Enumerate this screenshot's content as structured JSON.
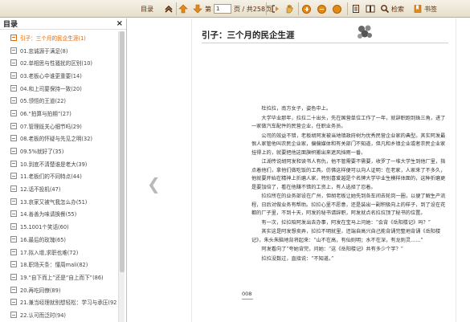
{
  "toolbar": {
    "toc_label": "目录",
    "page_prefix": "第",
    "page_value": "1",
    "page_suffix": "页 / 共258页",
    "search_label": "检索",
    "bookmark_label": "书签"
  },
  "sidebar": {
    "title": "目录",
    "close": "×",
    "items": [
      {
        "label": "引子：三个月的民企生涯(1)",
        "active": true
      },
      {
        "label": "01.忠诚源于满足(8)"
      },
      {
        "label": "02.单相思与性骚扰的区别(10)"
      },
      {
        "label": "03.老板心中谁更重要(14)"
      },
      {
        "label": "04.和上司要保持一致(20)"
      },
      {
        "label": "05.领悟的王道(22)"
      },
      {
        "label": "06.“拍算与拍期”(27)"
      },
      {
        "label": "07.管理既关心细节吗(29)"
      },
      {
        "label": "08.老板的怀疑与先见之明(32)"
      },
      {
        "label": "09.5%就好了(35)"
      },
      {
        "label": "10.到底不清楚谁是老大(39)"
      },
      {
        "label": "11.老板们的不同特点(44)"
      },
      {
        "label": "12.话不投机(47)"
      },
      {
        "label": "13.哀家又被气我怎么办(51)"
      },
      {
        "label": "14.善善为味请换餐(55)"
      },
      {
        "label": "15.1001个笑话(60)"
      },
      {
        "label": "16.最后的玫瑰(65)"
      },
      {
        "label": "17.拟入增,求职也难(72)"
      },
      {
        "label": "18.职场天条：懂周mali(82)"
      },
      {
        "label": "19.“自下而上”还是“自上而下”(86)"
      },
      {
        "label": "20.再吃同僚(89)"
      },
      {
        "label": "21.兼当经理就别想轻松：学习与承压(92)"
      },
      {
        "label": "22.认可而泛时(94)"
      }
    ]
  },
  "page": {
    "chapter_title": "引子：三个月的民企生涯",
    "page_number": "008",
    "paragraphs": [
      "杜拉拉，南方女子，姿色中上。",
      "大学毕业那年，拉拉二十出头，先在国营单位工作了一年，就辞职跑到珠三角，进了一家做汽车配件的民营企业，任职业务员。",
      "公司的效益不错，老板胡阿发被当地镇政府树为优秀民营企业家的典型。其实阿发最恨人家管他叫农民企业家，偏偏媒体和有关部门不知道，但凡和乡镇企业或者农民企业家挂得上的，就要把他这面旗帜搬出来遮风挡雨一番。",
      "江湖传说胡阿发和读书人有仇，他不管需要不需要，收罗了一堆大学生到他厂里，指点着他们，拿他们做吃饭的工具。仿佛这样便可以向人证明：在老家，人家来了不多久，他就要开始在精神上折磨人家，特别喜爱越是个名牌大学毕业生模样体面的，这种折磨更是要加倍了，看在他赚不错的工资上，有人选择了忍着。",
      "拉拉所在的业务部设在广州，但胡老板让她先到各车间去轮岗一圈，以便了解生产流程，日后对做业务有帮助。拉拉心里不愿意，还是装出一副积极向上的样子，到了设在花都的厂子里，不到十天，阿发的秘书请辞职，阿发就点名拉拉顶了秘书的位置。",
      "有一次，拉拉陪阿发出去办事，阿发在宝马上问她：“会背《岳阳楼记》吗？”",
      "其实这是阿发想卖弄，拉拉不明就里，还端自高兴自己能背诵完整地背诵《岳阳楼记》，朱头朱脑地背将起来：“山不在高，有仙则明；水不在深，有龙则灵……”",
      "阿发看向了“夸她背完，问她：“这《岳阳楼记》共有多少个字？”",
      "拉拉没数过，直接说：“不知道。”"
    ]
  },
  "colors": {
    "toolbar_text": "#5a2d0c",
    "active_item": "#e06000",
    "accent_icon": "#e08a1c"
  }
}
